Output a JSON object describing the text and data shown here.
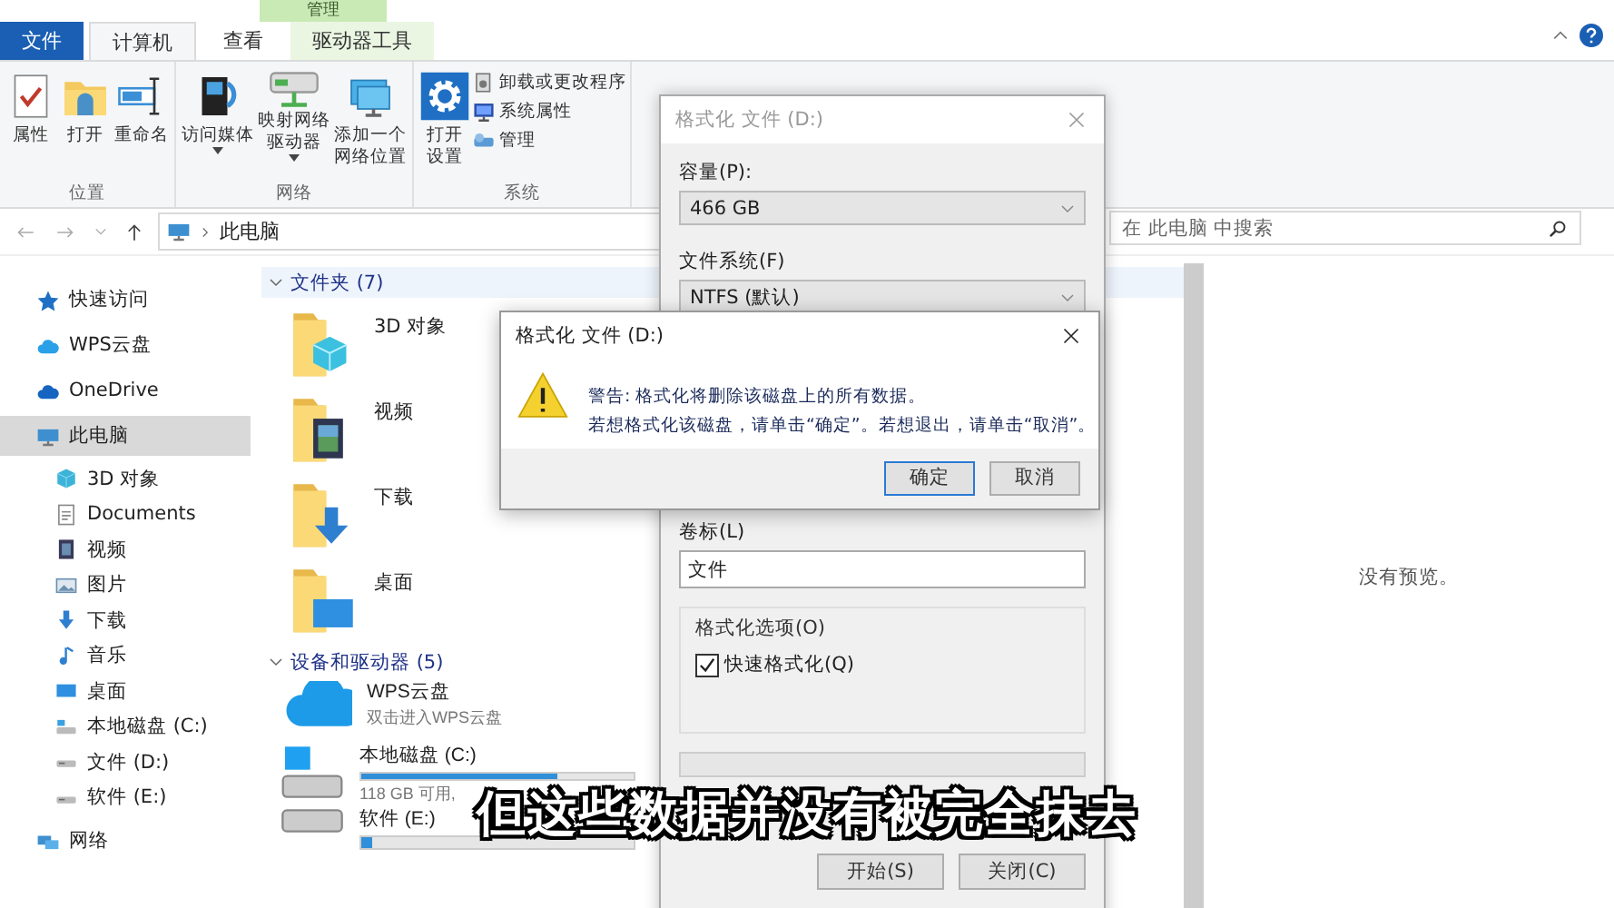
{
  "ribbon": {
    "context_header": "管理",
    "tabs": [
      {
        "label": "文件",
        "kind": "file",
        "selected": false
      },
      {
        "label": "计算机",
        "kind": "normal",
        "selected": true
      },
      {
        "label": "查看",
        "kind": "normal",
        "selected": false
      },
      {
        "label": "驱动器工具",
        "kind": "context",
        "selected": false
      }
    ],
    "groups": [
      {
        "label": "位置",
        "commands": [
          {
            "lines": [
              "属性"
            ],
            "dropdown": false
          },
          {
            "lines": [
              "打开"
            ],
            "dropdown": false
          },
          {
            "lines": [
              "重命名"
            ],
            "dropdown": false
          }
        ]
      },
      {
        "label": "网络",
        "commands": [
          {
            "lines": [
              "访问媒体"
            ],
            "dropdown": true
          },
          {
            "lines": [
              "映射网络",
              "驱动器"
            ],
            "dropdown": true
          },
          {
            "lines": [
              "添加一个",
              "网络位置"
            ],
            "dropdown": false
          }
        ]
      },
      {
        "label": "系统",
        "commands": [
          {
            "lines": [
              "打开",
              "设置"
            ],
            "dropdown": false
          }
        ],
        "small_commands": [
          "卸载或更改程序",
          "系统属性",
          "管理"
        ]
      }
    ]
  },
  "address": {
    "path": "此电脑",
    "search_placeholder": "在 此电脑 中搜索"
  },
  "sidebar": {
    "items": [
      {
        "label": "快速访问",
        "selected": false
      },
      {
        "label": "WPS云盘",
        "selected": false
      },
      {
        "label": "OneDrive",
        "selected": false
      },
      {
        "label": "此电脑",
        "selected": true,
        "children": [
          {
            "label": "3D 对象",
            "selected": false
          },
          {
            "label": "Documents",
            "selected": false
          },
          {
            "label": "视频",
            "selected": false
          },
          {
            "label": "图片",
            "selected": false
          },
          {
            "label": "下载",
            "selected": false
          },
          {
            "label": "音乐",
            "selected": false
          },
          {
            "label": "桌面",
            "selected": false
          },
          {
            "label": "本地磁盘 (C:)",
            "selected": false
          },
          {
            "label": "文件 (D:)",
            "selected": false
          },
          {
            "label": "软件 (E:)",
            "selected": false
          }
        ]
      },
      {
        "label": "网络",
        "selected": false
      }
    ]
  },
  "sections": [
    {
      "title": "文件夹 (7)",
      "kind": "folders",
      "expanded": true,
      "items": [
        {
          "name": "3D 对象"
        },
        {
          "name": "视频"
        },
        {
          "name": "下载"
        },
        {
          "name": "桌面"
        }
      ]
    },
    {
      "title": "设备和驱动器 (5)",
      "kind": "drives",
      "expanded": true,
      "items": [
        {
          "name": "WPS云盘",
          "kind": "cloud",
          "detail": "双击进入WPS云盘"
        },
        {
          "name": "本地磁盘 (C:)",
          "kind": "drive",
          "level": 0.72,
          "detail": "118 GB 可用,"
        },
        {
          "name": "软件 (E:)",
          "kind": "drive",
          "level": 0.04
        }
      ]
    }
  ],
  "preview": {
    "message": "没有预览。"
  },
  "format_dialog": {
    "title": "格式化 文件 (D:)",
    "active": false,
    "fields": [
      {
        "label": "容量(P):",
        "kind": "select",
        "value": "466 GB"
      },
      {
        "label": "文件系统(F)",
        "kind": "select",
        "value": "NTFS (默认)"
      },
      {
        "label": "卷标(L)",
        "kind": "text",
        "value": "文件"
      }
    ],
    "options_title": "格式化选项(O)",
    "checkboxes": [
      {
        "label": "快速格式化(Q)",
        "checked": true
      }
    ],
    "progress": {
      "level": 0
    },
    "buttons": [
      "开始(S)",
      "关闭(C)"
    ]
  },
  "confirm_dialog": {
    "title": "格式化 文件 (D:)",
    "active": true,
    "message_lines": [
      "警告: 格式化将删除该磁盘上的所有数据。",
      "若想格式化该磁盘，请单击“确定”。若想退出，请单击“取消”。"
    ],
    "buttons": [
      {
        "label": "确定",
        "default": true
      },
      {
        "label": "取消",
        "default": false
      }
    ]
  },
  "subtitle": "但这些数据并没有被完全抹去"
}
